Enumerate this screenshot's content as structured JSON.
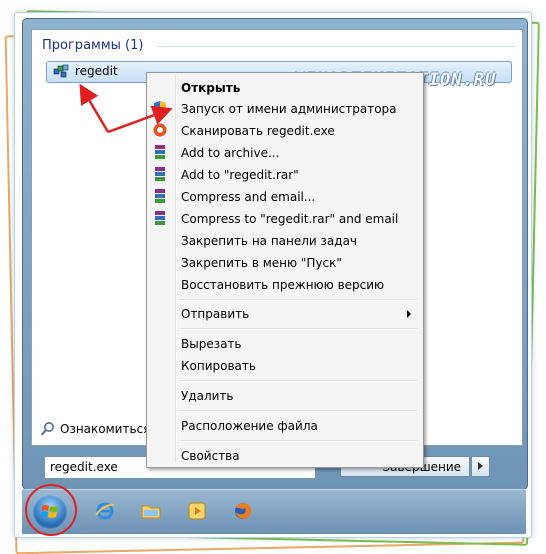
{
  "start_menu": {
    "section_title": "Программы (1)",
    "program": "regedit",
    "see_more": "Ознакомиться с",
    "search_value": "regedit.exe",
    "shutdown_label": "Завершение работы"
  },
  "watermark": "WINOPTIMIZATION.RU",
  "context_menu": {
    "items": [
      "Открыть",
      "Запуск от имени администратора",
      "Сканировать regedit.exe",
      "Add to archive...",
      "Add to \"regedit.rar\"",
      "Compress and email...",
      "Compress to \"regedit.rar\" and email",
      "Закрепить на панели задач",
      "Закрепить в меню \"Пуск\"",
      "Восстановить прежнюю версию",
      "Отправить",
      "Вырезать",
      "Копировать",
      "Удалить",
      "Расположение файла",
      "Свойства"
    ]
  },
  "taskbar": {
    "icons": [
      "start-orb-icon",
      "internet-explorer-icon",
      "folder-icon",
      "media-player-icon",
      "firefox-icon"
    ]
  },
  "colors": {
    "accent": "#1e3287",
    "highlight_circle": "#e02020",
    "arrow": "#e02020"
  }
}
